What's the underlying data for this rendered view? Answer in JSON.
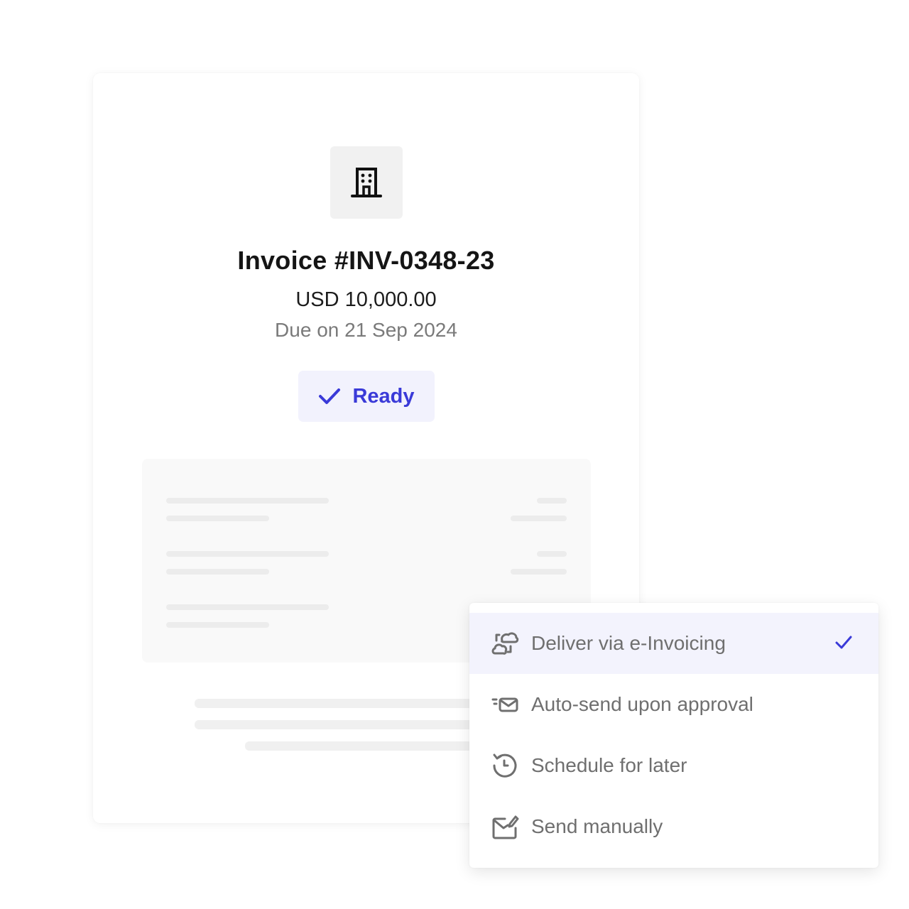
{
  "invoice": {
    "logo_icon": "building-icon",
    "title": "Invoice #INV-0348-23",
    "amount": "USD 10,000.00",
    "due": "Due on 21 Sep 2024",
    "status": {
      "label": "Ready",
      "icon": "check-icon",
      "color": "#3a3ad8",
      "background": "#f2f2fd"
    }
  },
  "delivery_menu": {
    "items": [
      {
        "label": "Deliver via e-Invoicing",
        "icon": "cloud-sync-icon",
        "selected": true
      },
      {
        "label": "Auto-send upon approval",
        "icon": "fast-mail-icon",
        "selected": false
      },
      {
        "label": "Schedule for later",
        "icon": "clock-history-icon",
        "selected": false
      },
      {
        "label": "Send manually",
        "icon": "mail-edit-icon",
        "selected": false
      }
    ],
    "selected_check_icon": "check-icon",
    "accent_color": "#3a3ad8",
    "selected_background": "#f3f3fd"
  }
}
